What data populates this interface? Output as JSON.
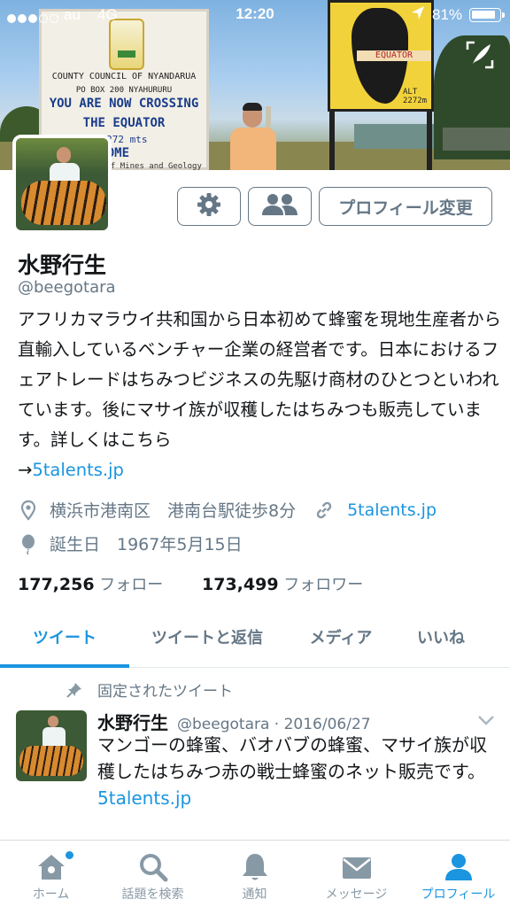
{
  "status_bar": {
    "carrier": "au",
    "network": "4G",
    "time": "12:20",
    "battery": "81%",
    "signal_dots_filled": 3,
    "signal_dots_total": 5
  },
  "banner": {
    "sign1_lines": [
      "COUNTY COUNCIL OF NYANDARUA",
      "PO BOX 200 NYAHURURU",
      "YOU ARE NOW CROSSING",
      "THE EQUATOR",
      "ALT 2272 mts",
      "WELCOME",
      "Dept. of Mines and Geology"
    ],
    "sign2_band": "EQUATOR",
    "sign2_alt": "ALT 2272m"
  },
  "profile": {
    "name": "水野行生",
    "handle": "@beegotara",
    "bio": "アフリカマラウイ共和国から日本初めて蜂蜜を現地生産者から直輸入しているベンチャー企業の経営者です。日本におけるフェアトレードはちみつビジネスの先駆け商材のひとつといわれています。後にマサイ族が収穫したはちみつも販売しています。詳しくはこちら",
    "bio_link_prefix": "→",
    "bio_link": "5talents.jp",
    "location": "横浜市港南区　港南台駅徒歩8分",
    "website": "5talents.jp",
    "birthday": "誕生日　1967年5月15日",
    "following_count": "177,256",
    "following_label": "フォロー",
    "followers_count": "173,499",
    "followers_label": "フォロワー"
  },
  "buttons": {
    "edit_profile": "プロフィール変更"
  },
  "tabs": [
    {
      "label": "ツイート",
      "active": true
    },
    {
      "label": "ツイートと返信",
      "active": false
    },
    {
      "label": "メディア",
      "active": false
    },
    {
      "label": "いいね",
      "active": false
    }
  ],
  "pinned_tweet": {
    "pinned_label": "固定されたツイート",
    "name": "水野行生",
    "handle_date": "@beegotara · 2016/06/27",
    "text": "マンゴーの蜂蜜、バオバブの蜂蜜、マサイ族が収穫したはちみつ赤の戦士蜂蜜のネット販売です。",
    "link": "5talents.jp"
  },
  "bottom_nav": [
    {
      "label": "ホーム",
      "icon": "home-icon",
      "active": false
    },
    {
      "label": "話題を検索",
      "icon": "search-icon",
      "active": false
    },
    {
      "label": "通知",
      "icon": "bell-icon",
      "active": false
    },
    {
      "label": "メッセージ",
      "icon": "envelope-icon",
      "active": false
    },
    {
      "label": "プロフィール",
      "icon": "person-icon",
      "active": true
    }
  ],
  "colors": {
    "accent": "#1b95e0",
    "secondary_text": "#657786",
    "primary_text": "#14171a"
  }
}
